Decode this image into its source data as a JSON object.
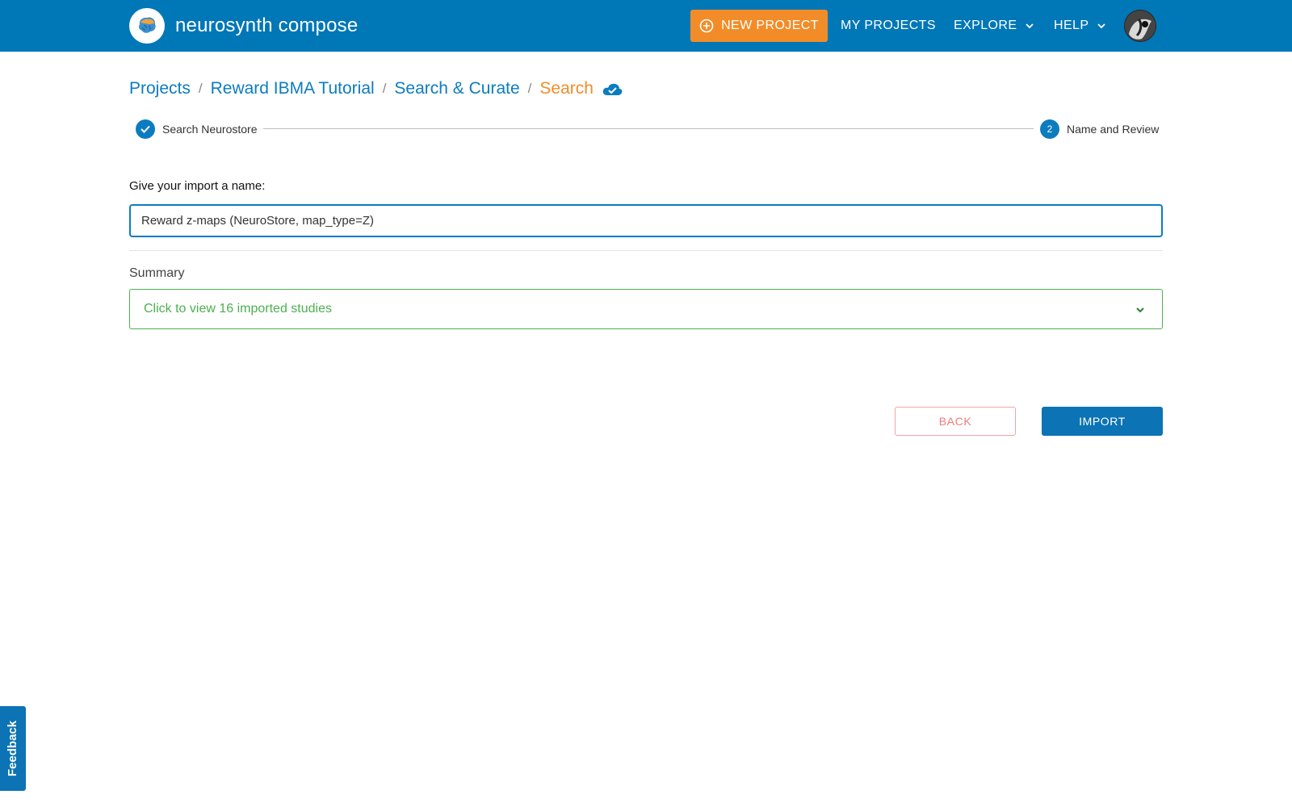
{
  "app": {
    "name": "neurosynth compose"
  },
  "nav": {
    "new_project": "NEW PROJECT",
    "my_projects": "MY PROJECTS",
    "explore": "EXPLORE",
    "help": "HELP"
  },
  "breadcrumb": {
    "items": [
      "Projects",
      "Reward IBMA Tutorial",
      "Search & Curate",
      "Search"
    ],
    "separator": "/"
  },
  "stepper": {
    "steps": [
      {
        "label": "Search Neurostore",
        "state": "completed"
      },
      {
        "number": "2",
        "label": "Name and Review",
        "state": "active"
      }
    ]
  },
  "form": {
    "name_label": "Give your import a name:",
    "name_value": "Reward z-maps (NeuroStore, map_type=Z)",
    "summary_label": "Summary",
    "summary_toggle": "Click to view 16 imported studies"
  },
  "actions": {
    "back": "BACK",
    "import": "IMPORT"
  },
  "feedback": "Feedback",
  "colors": {
    "primary": "#0077b6",
    "accent": "#f28c28",
    "success": "#4caf50",
    "danger_light": "#ef7c7c"
  }
}
